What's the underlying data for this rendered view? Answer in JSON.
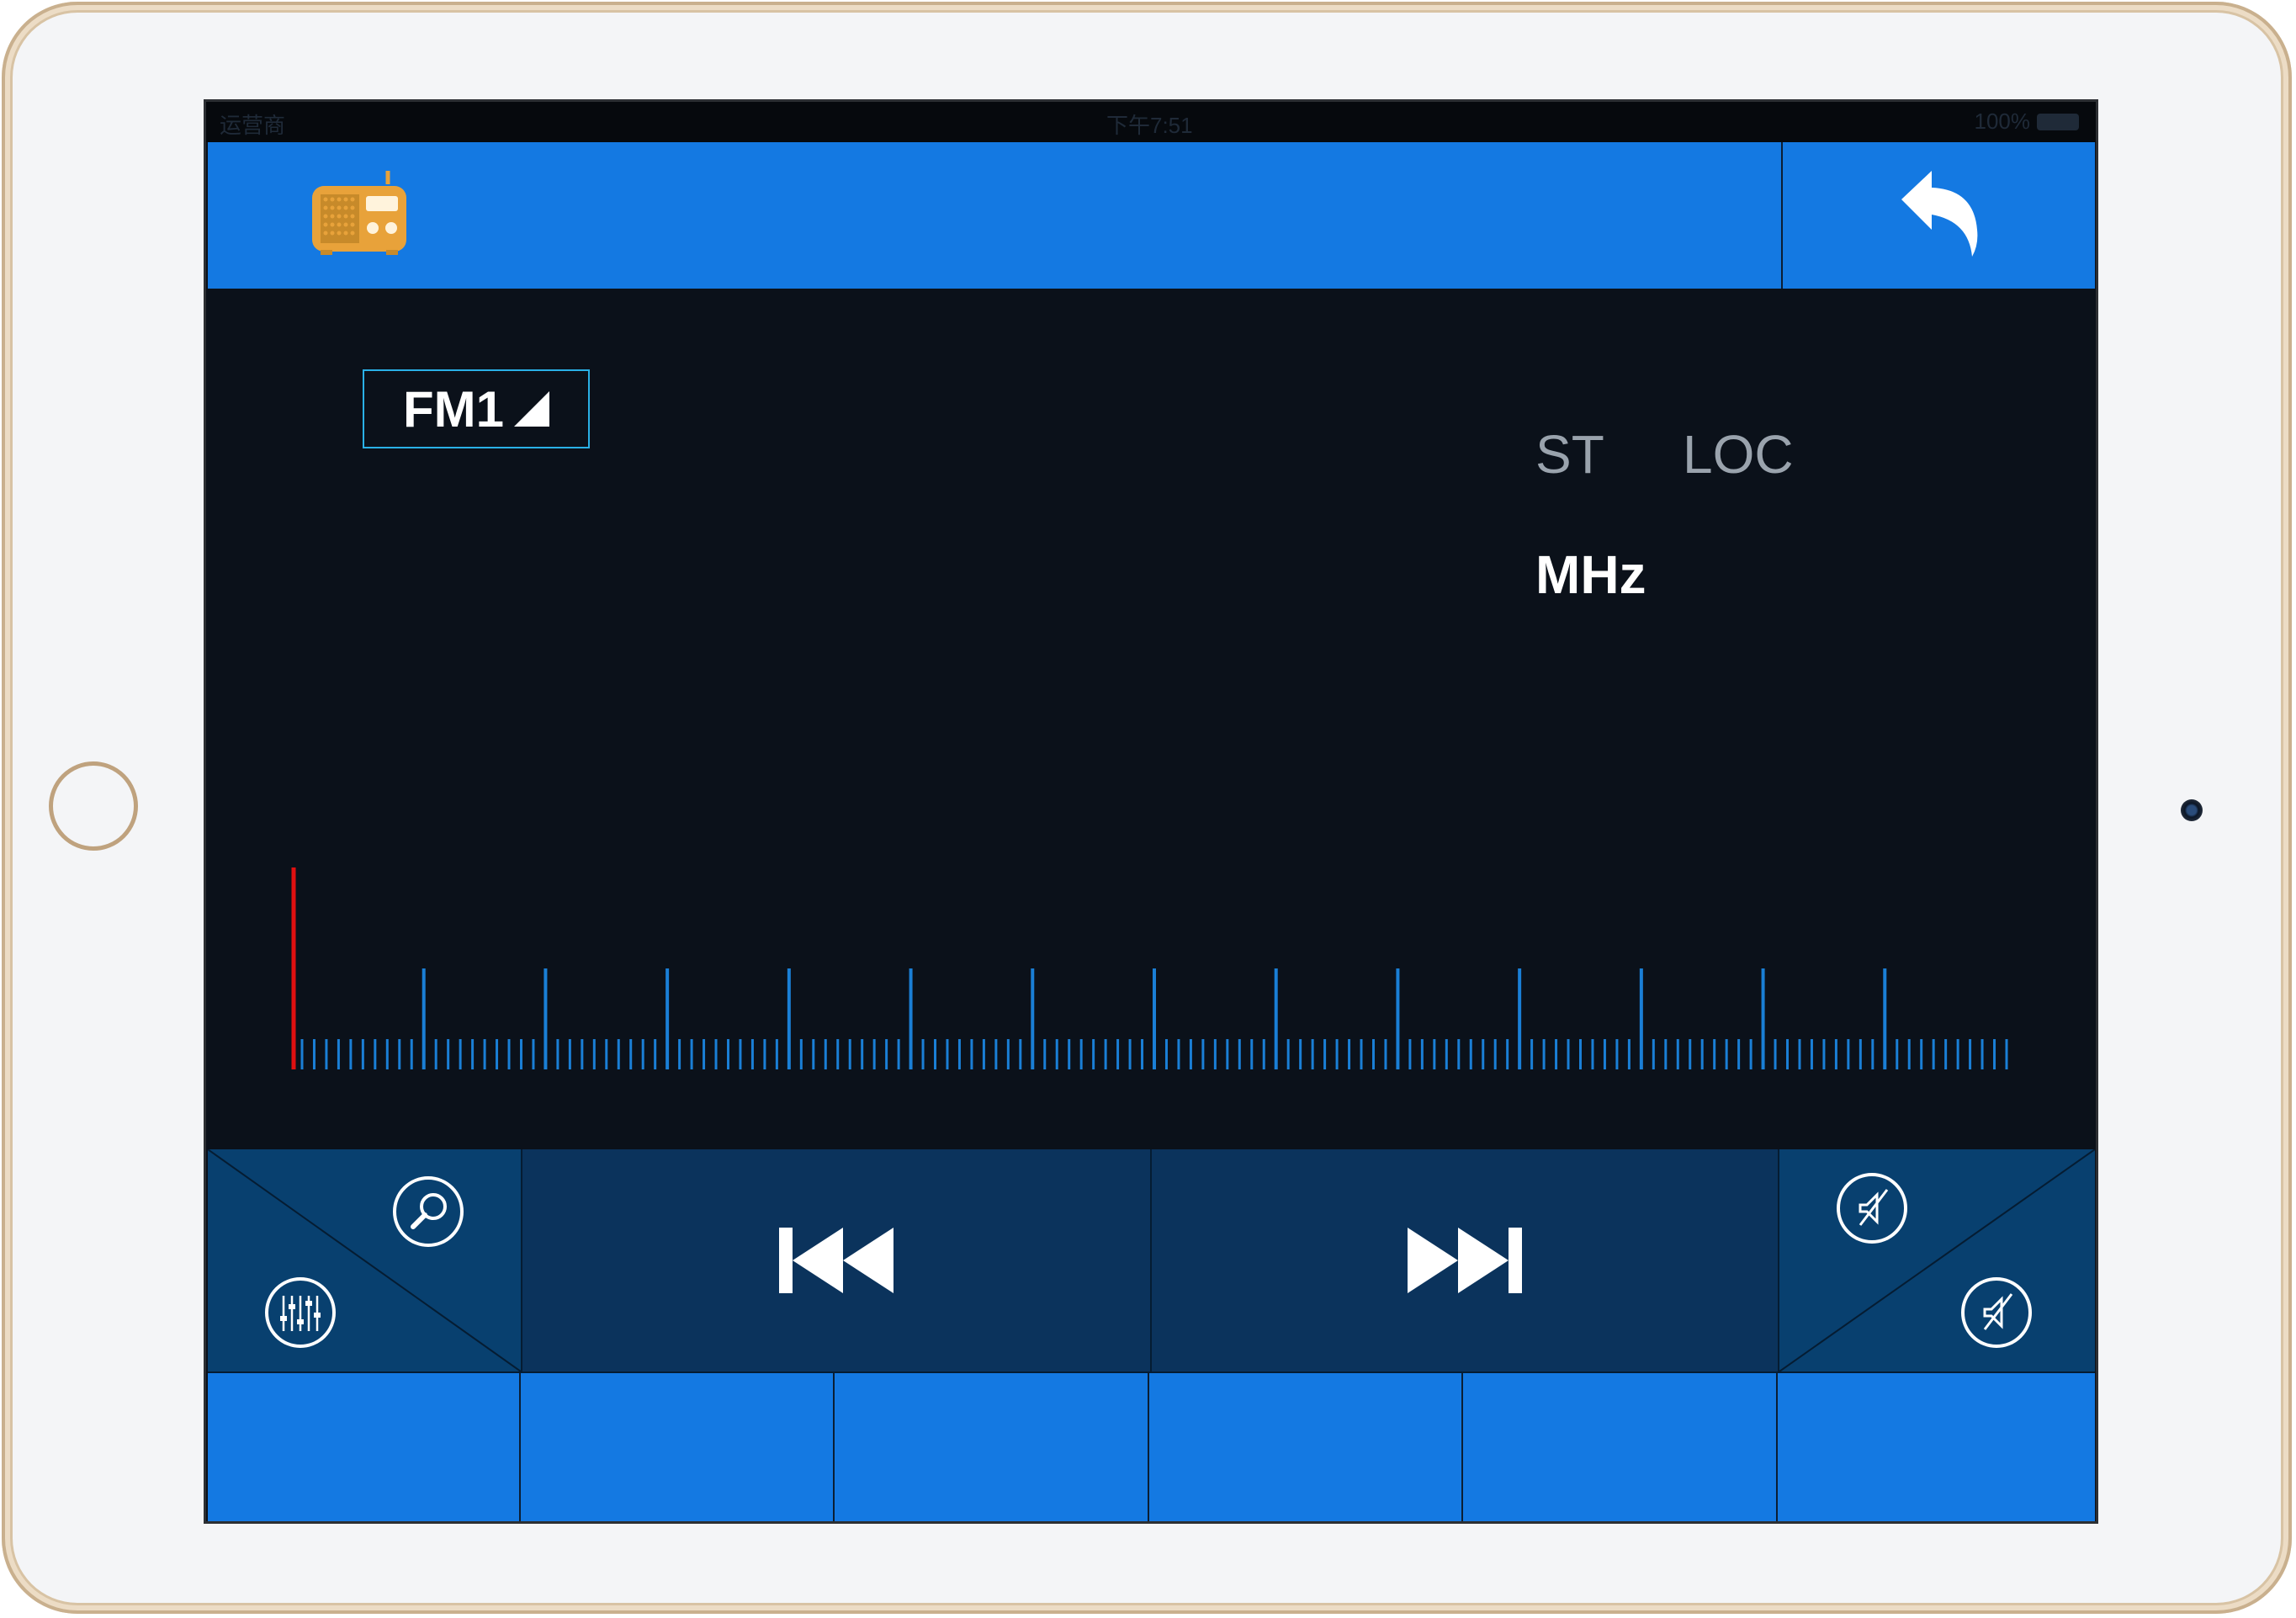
{
  "status_bar": {
    "carrier": "运营商",
    "time": "下午7:51",
    "battery": "100%"
  },
  "header": {
    "logo_icon": "radio-icon",
    "back_icon": "back-arrow-icon"
  },
  "band": {
    "label": "FM1",
    "arrow_icon": "triangle-corner-icon"
  },
  "indicators": {
    "st": "ST",
    "loc": "LOC",
    "unit": "MHz"
  },
  "tuner": {
    "needle_color": "#e01010",
    "tick_color": "#1a7fd6",
    "needle_position": 0.0
  },
  "controls": {
    "search_icon": "search-icon",
    "eq_icon": "equalizer-icon",
    "prev_icon": "skip-previous-icon",
    "next_icon": "skip-next-icon",
    "mute_icon": "speaker-mute-icon",
    "mute_icon_2": "speaker-mute-icon"
  },
  "presets": [
    "",
    "",
    "",
    "",
    "",
    ""
  ],
  "colors": {
    "accent": "#1479e2",
    "screen_bg": "#0b111a",
    "control_bg": "#0b335c",
    "logo": "#e8a23a"
  }
}
